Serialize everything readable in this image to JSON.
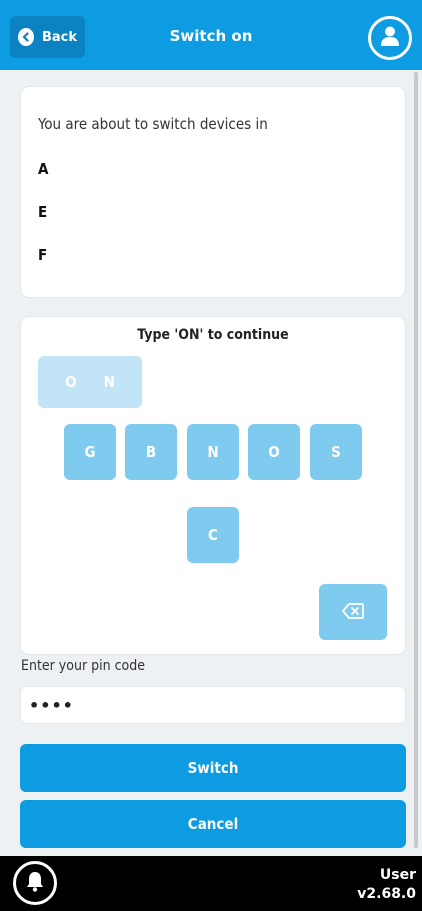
{
  "header": {
    "back_label": "Back",
    "title": "Switch on",
    "back_icon": "chevron-left-icon",
    "profile_icon": "user-icon"
  },
  "info": {
    "intro": "You are about to switch devices in",
    "devices": [
      "A",
      "E",
      "F"
    ]
  },
  "keypad": {
    "title": "Type 'ON' to continue",
    "typed": [
      "O",
      "N"
    ],
    "keys": [
      "G",
      "B",
      "N",
      "O",
      "S",
      "C"
    ],
    "backspace_icon": "backspace-icon"
  },
  "pin": {
    "label": "Enter your pin code",
    "value": "••••"
  },
  "actions": {
    "switch_label": "Switch",
    "cancel_label": "Cancel"
  },
  "footer": {
    "bell_icon": "bell-icon",
    "user": "User",
    "version": "v2.68.0"
  },
  "colors": {
    "primary": "#0d9be2",
    "key": "#7fcbef",
    "typed_box": "#c1e4f6",
    "footer": "#000000"
  }
}
